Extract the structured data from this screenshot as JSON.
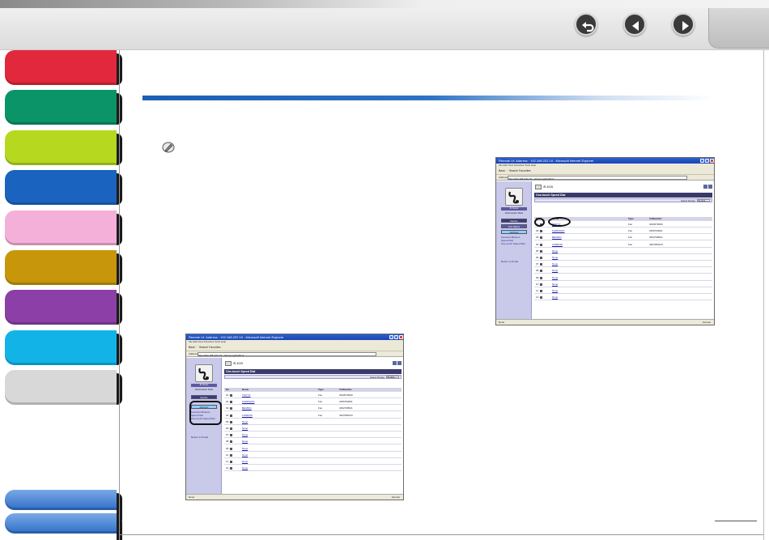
{
  "nav": {
    "back_icon": "return-arrow-icon",
    "prev_icon": "left-triangle-icon",
    "next_icon": "right-triangle-icon"
  },
  "colors": {
    "tabs": [
      "#e2283c",
      "#0b9467",
      "#b6d81e",
      "#1a64c0",
      "#f5b0da",
      "#c8960a",
      "#8c3fa6",
      "#12b4e8",
      "#d8d8d8",
      "#3f7fd2",
      "#3f7fd2"
    ],
    "accent_rule": "#1a5fb4"
  },
  "screenshot_large": {
    "window_title": "Remote UI: Address : 192.168.222.19 - Microsoft Internet Explorer",
    "menu": "File  Edit  View  Favorites  Tools  Help",
    "toolbar": "Back  ·  ·  Search  Favorites",
    "address_label": "Address",
    "address_value": "http://192.168.222.19/.../abook.cgi?addr=1",
    "logo_caption": "iR Series",
    "side_subtitle": "Administrator Mode",
    "side_buttons": [
      "Device",
      "Job Status",
      "Address"
    ],
    "side_links": [
      "Favorites Buttons",
      "Speed Dial",
      "One-touch Speed Dial",
      "Return to Portal"
    ],
    "header_icon": "printer-icon",
    "header_text": "iR-4026",
    "panel_title": "One-touch Speed Dial",
    "select_range_label": "Select Range",
    "select_range_value": "01-012",
    "col_headers": [
      "No.",
      "",
      "Name",
      "Type",
      "To/Number"
    ],
    "rows": [
      {
        "no": "01",
        "name": "TOKYO",
        "type": "Fax",
        "number": "3333670000"
      },
      {
        "no": "02",
        "name": "KAWASAKI",
        "type": "Fax",
        "number": "2266700001"
      },
      {
        "no": "03",
        "name": "BEIJING",
        "type": "Fax",
        "number": "3452708521"
      },
      {
        "no": "04",
        "name": "LONDON",
        "type": "Fax",
        "number": "4407080123"
      },
      {
        "no": "05",
        "name": "None",
        "type": "",
        "number": ""
      },
      {
        "no": "06",
        "name": "None",
        "type": "",
        "number": ""
      },
      {
        "no": "07",
        "name": "None",
        "type": "",
        "number": ""
      },
      {
        "no": "08",
        "name": "None",
        "type": "",
        "number": ""
      },
      {
        "no": "09",
        "name": "None",
        "type": "",
        "number": ""
      },
      {
        "no": "10",
        "name": "None",
        "type": "",
        "number": ""
      },
      {
        "no": "11",
        "name": "None",
        "type": "",
        "number": ""
      },
      {
        "no": "12",
        "name": "None",
        "type": "",
        "number": ""
      }
    ],
    "status_left": "Done",
    "status_right": "Internet"
  },
  "screenshot_small": {
    "window_title": "Remote UI: Address : 192.168.222.19 - Microsoft Internet Explorer",
    "menu": "File  Edit  View  Favorites  Tools  Help",
    "toolbar": "Back  ·  ·  Search  Favorites",
    "address_label": "Address",
    "address_value": "http://192.168.222.19/.../abook.cgi?addr=1",
    "logo_caption": "iR Series",
    "side_subtitle": "Administrator Mode",
    "side_buttons": [
      "Device",
      "Address"
    ],
    "side_links": [
      "Favorites Buttons",
      "Speed Dial",
      "One-touch Speed Dial",
      "Return to Portal"
    ],
    "header_text": "iR-4026",
    "panel_title": "One-touch Speed Dial",
    "select_range_label": "Select Range",
    "select_range_value": "01-012",
    "col_headers": [
      "No.",
      "",
      "Name",
      "Type",
      "To/Number"
    ],
    "rows": [
      {
        "no": "01",
        "name": "TOKYO",
        "type": "Fax",
        "number": "3333670000"
      },
      {
        "no": "02",
        "name": "KAWASAKI",
        "type": "Fax",
        "number": "2266700001"
      },
      {
        "no": "03",
        "name": "BEIJING",
        "type": "Fax",
        "number": "3452708521"
      },
      {
        "no": "04",
        "name": "LONDON",
        "type": "Fax",
        "number": "4407080123"
      },
      {
        "no": "05",
        "name": "None",
        "type": "",
        "number": ""
      },
      {
        "no": "06",
        "name": "None",
        "type": "",
        "number": ""
      },
      {
        "no": "07",
        "name": "None",
        "type": "",
        "number": ""
      },
      {
        "no": "08",
        "name": "None",
        "type": "",
        "number": ""
      },
      {
        "no": "09",
        "name": "None",
        "type": "",
        "number": ""
      },
      {
        "no": "10",
        "name": "None",
        "type": "",
        "number": ""
      },
      {
        "no": "11",
        "name": "None",
        "type": "",
        "number": ""
      },
      {
        "no": "12",
        "name": "None",
        "type": "",
        "number": ""
      }
    ],
    "status_left": "Done",
    "status_right": "Internet"
  }
}
